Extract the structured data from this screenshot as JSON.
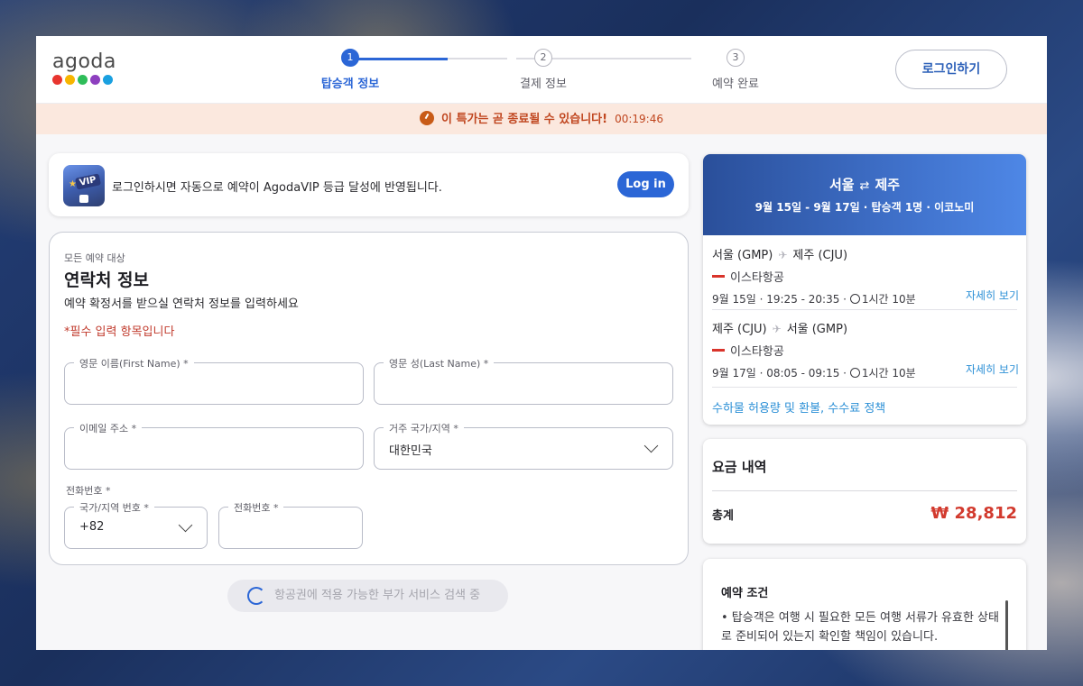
{
  "brand": {
    "name": "agoda",
    "dot_colors": [
      "#e8352f",
      "#f7b500",
      "#2ebd59",
      "#8d3fbf",
      "#1aa0e0"
    ]
  },
  "steps": [
    {
      "num": "1",
      "label": "탑승객 정보",
      "active": true
    },
    {
      "num": "2",
      "label": "결제 정보",
      "active": false
    },
    {
      "num": "3",
      "label": "예약 완료",
      "active": false
    }
  ],
  "header": {
    "login_label": "로그인하기"
  },
  "deal": {
    "text": "이 특가는 곧 종료될 수 있습니다!",
    "timer": "00:19:46"
  },
  "vip": {
    "icon_tag": "VIP",
    "text": "로그인하시면 자동으로 예약이 AgodaVIP 등급 달성에 반영됩니다.",
    "button": "Log in"
  },
  "contact": {
    "eyebrow": "모든 예약 대상",
    "title": "연락처 정보",
    "subtitle": "예약 확정서를 받으실 연락처 정보를 입력하세요",
    "required_note": "*필수 입력 항목입니다",
    "fields": {
      "first_name": {
        "label": "영문 이름(First Name) *",
        "value": ""
      },
      "last_name": {
        "label": "영문 성(Last Name) *",
        "value": ""
      },
      "email": {
        "label": "이메일 주소 *",
        "value": ""
      },
      "country": {
        "label": "거주 국가/지역 *",
        "value": "대한민국"
      },
      "phone_section_label": "전화번호 *",
      "phone_code": {
        "label": "국가/지역 번호 *",
        "value": "+82"
      },
      "phone_number": {
        "label": "전화번호 *",
        "value": ""
      }
    }
  },
  "addon": {
    "text": "항공권에 적용 가능한 부가 서비스 검색 중"
  },
  "trip": {
    "from": "서울",
    "to": "제주",
    "swap_icon": "⇄",
    "meta": "9월 15일 - 9월 17일 · 탑승객 1명 · 이코노미",
    "segments": [
      {
        "origin": "서울 (GMP)",
        "dest": "제주 (CJU)",
        "airline": "이스타항공",
        "times_prefix": "9월 15일 · 19:25 - 20:35 ·",
        "duration": "1시간 10분",
        "details": "자세히 보기"
      },
      {
        "origin": "제주 (CJU)",
        "dest": "서울 (GMP)",
        "airline": "이스타항공",
        "times_prefix": "9월 17일 · 08:05 - 09:15 ·",
        "duration": "1시간 10분",
        "details": "자세히 보기"
      }
    ],
    "baggage_link": "수하물 허용량 및 환불, 수수료 정책"
  },
  "price": {
    "title": "요금 내역",
    "total_label": "총계",
    "total": "₩ 28,812"
  },
  "terms": {
    "title": "예약 조건",
    "body": "• 탑승객은 여행 시 필요한 모든 여행 서류가 유효한 상태로 준비되어 있는지 확인할 책임이 있습니다."
  }
}
